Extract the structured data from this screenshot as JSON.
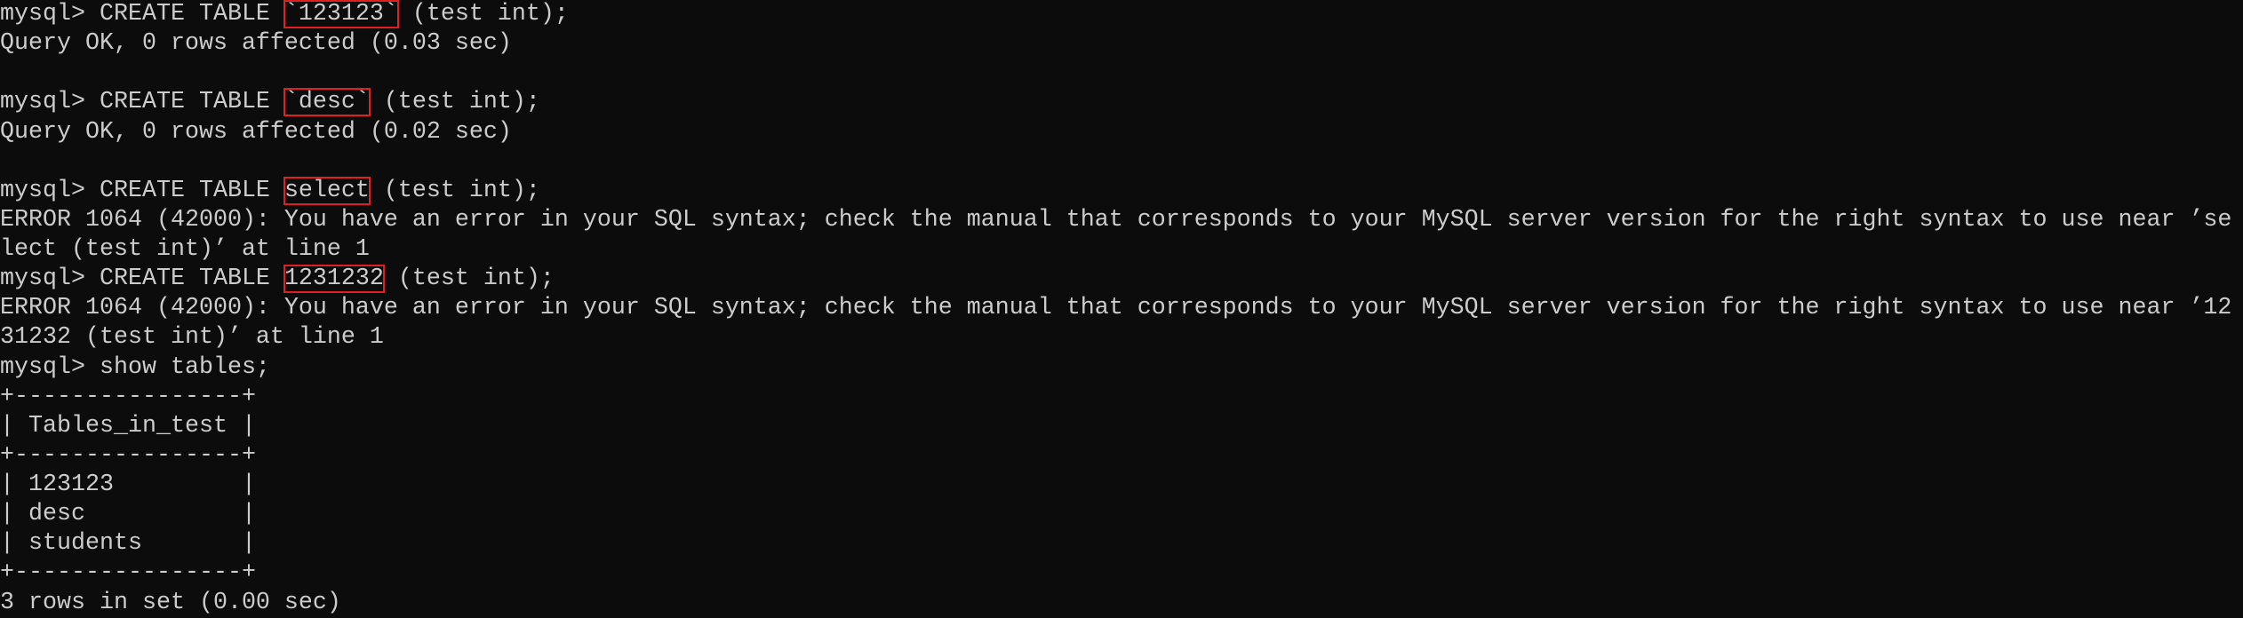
{
  "terminal": {
    "background": "#0c0c0c",
    "foreground": "#cccccc",
    "highlight_color": "#e02020",
    "lines": [
      {
        "pre": "mysql> CREATE TABLE ",
        "hl": "`123123`",
        "post": " (test int);"
      },
      {
        "pre": "Query OK, 0 rows affected (0.03 sec)"
      },
      {
        "pre": ""
      },
      {
        "pre": "mysql> CREATE TABLE ",
        "hl": "`desc`",
        "post": " (test int);"
      },
      {
        "pre": "Query OK, 0 rows affected (0.02 sec)"
      },
      {
        "pre": ""
      },
      {
        "pre": "mysql> CREATE TABLE ",
        "hl": "select",
        "post": " (test int);"
      },
      {
        "pre": "ERROR 1064 (42000): You have an error in your SQL syntax; check the manual that corresponds to your MySQL server version for the right syntax to use near ’se"
      },
      {
        "pre": "lect (test int)’ at line 1"
      },
      {
        "pre": "mysql> CREATE TABLE ",
        "hl": "1231232",
        "post": " (test int);"
      },
      {
        "pre": "ERROR 1064 (42000): You have an error in your SQL syntax; check the manual that corresponds to your MySQL server version for the right syntax to use near ’12"
      },
      {
        "pre": "31232 (test int)’ at line 1"
      },
      {
        "pre": "mysql> show tables;"
      },
      {
        "pre": "+----------------+"
      },
      {
        "pre": "| Tables_in_test |"
      },
      {
        "pre": "+----------------+"
      },
      {
        "pre": "| 123123         |"
      },
      {
        "pre": "| desc           |"
      },
      {
        "pre": "| students       |"
      },
      {
        "pre": "+----------------+"
      },
      {
        "pre": "3 rows in set (0.00 sec)"
      }
    ]
  }
}
